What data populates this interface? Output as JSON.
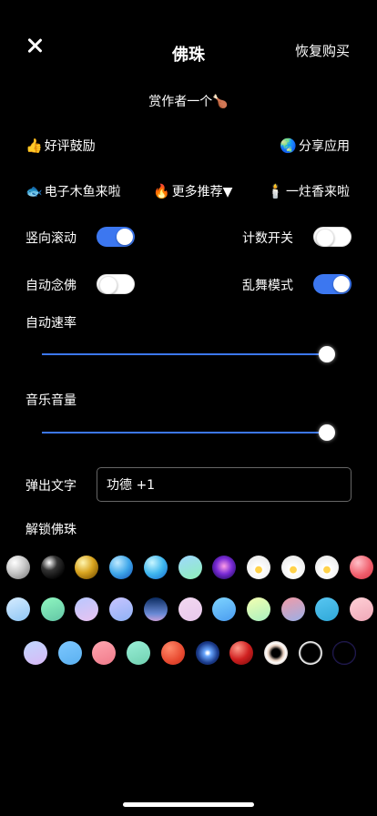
{
  "header": {
    "title": "佛珠",
    "restore_label": "恢复购买"
  },
  "reward": {
    "label": "赏作者一个",
    "emoji": "🍗"
  },
  "links": {
    "review": {
      "emoji": "👍",
      "label": "好评鼓励"
    },
    "share": {
      "emoji": "🌏",
      "label": "分享应用"
    },
    "muyu": {
      "emoji": "🐟",
      "label": "电子木鱼来啦"
    },
    "more": {
      "emoji": "🔥",
      "label": "更多推荐▼"
    },
    "incense": {
      "emoji": "🕯️",
      "label": "一炷香来啦"
    }
  },
  "settings": {
    "vertical_scroll": {
      "label": "竖向滚动",
      "on": true
    },
    "counter": {
      "label": "计数开关",
      "on": false
    },
    "auto_chant": {
      "label": "自动念佛",
      "on": false
    },
    "wild_mode": {
      "label": "乱舞模式",
      "on": true
    }
  },
  "auto_speed": {
    "label": "自动速率",
    "value": 1.0
  },
  "music_volume": {
    "label": "音乐音量",
    "value": 1.0
  },
  "popup_text": {
    "label": "弹出文字",
    "value": "功德 +1"
  },
  "unlock": {
    "label": "解锁佛珠"
  },
  "beads": [
    [
      "radial-gradient(circle at 35% 30%, #ffffff, #c8c8c8 45%, #8a8a8a 85%)",
      "radial-gradient(circle at 35% 30%, #ffffff, #333 35%, #000 80%)",
      "radial-gradient(circle at 35% 30%, #fff6b0, #d9a520 45%, #7a5200 90%)",
      "radial-gradient(circle at 35% 30%, #bfeaff, #3fa7ea 50%, #1656b8 95%)",
      "radial-gradient(circle at 35% 30%, #c8f6ff, #3fb7ee 50%, #1a6fd0 95%)",
      "linear-gradient(160deg, #9fd8ff, #8ff0b8)",
      "radial-gradient(circle at 50% 45%, #ff9de6, #7a2bd6 45%, #1c0a5a 90%)",
      "radial-gradient(circle at 50% 60%, #ffd24a 0 18%, #ffffff 20%, #e8e8e8 90%)",
      "radial-gradient(circle at 50% 60%, #ffd24a 0 18%, #ffffff 20%, #e8e8e8 90%)",
      "radial-gradient(circle at 50% 60%, #ffd24a 0 18%, #ffffff 20%, #e8e8e8 90%)",
      "radial-gradient(circle at 35% 30%, #ffc0c8, #f0606e 55%, #d83a4a 95%)"
    ],
    [
      "linear-gradient(160deg, #d6ecff, #8fc6f5)",
      "linear-gradient(160deg, #8ff7c0, #63c6a6)",
      "linear-gradient(160deg, #b8c8ff, #e9c2f0)",
      "linear-gradient(160deg, #c8c4ff, #8fb2f5)",
      "linear-gradient(180deg, #0a2a5e, #6a8ad6 70%, #c8a0d8)",
      "linear-gradient(160deg, #f2d8f0, #e8c8ec)",
      "linear-gradient(160deg, #7ed4ff, #4a9cf0)",
      "linear-gradient(160deg, #f5ffb0, #a8f0c0)",
      "linear-gradient(160deg, #f29aa6, #9ab0e8)",
      "linear-gradient(160deg, #58c6f2, #2fa8d8)",
      "linear-gradient(160deg, #ffd0d6, #f0a8b8)"
    ],
    [
      "linear-gradient(160deg, #c0d8ff, #d8b8f5)",
      "linear-gradient(160deg, #7ec8ff, #5ab0f0)",
      "linear-gradient(160deg, #ffa6b0, #f07a8a)",
      "linear-gradient(160deg, #9af0d8, #70d0b0)",
      "radial-gradient(circle at 35% 30%, #ff8a6a, #e84a30 60%, #c03020)",
      "radial-gradient(circle at 50% 50%, #ffffff 0 6%, #6aa8ff 20%, #1a3a8a 60%, #0a1a40 95%)",
      "radial-gradient(circle at 35% 30%, #ff9a8a, #d02020 50%, #7a0a0a 95%)",
      "radial-gradient(circle at 50% 50%, #000 0 25%, #e8d0c0 45%, #ffffff 60%, #7a5a4a 95%)",
      "radial-gradient(circle at 50% 50%, #000 0 55%, #ffffff 65%, #888 80%, #000 95%)",
      "radial-gradient(circle at 50% 50%, #000 0 60%, #4a3ab8 78%, #000 95%)"
    ]
  ]
}
